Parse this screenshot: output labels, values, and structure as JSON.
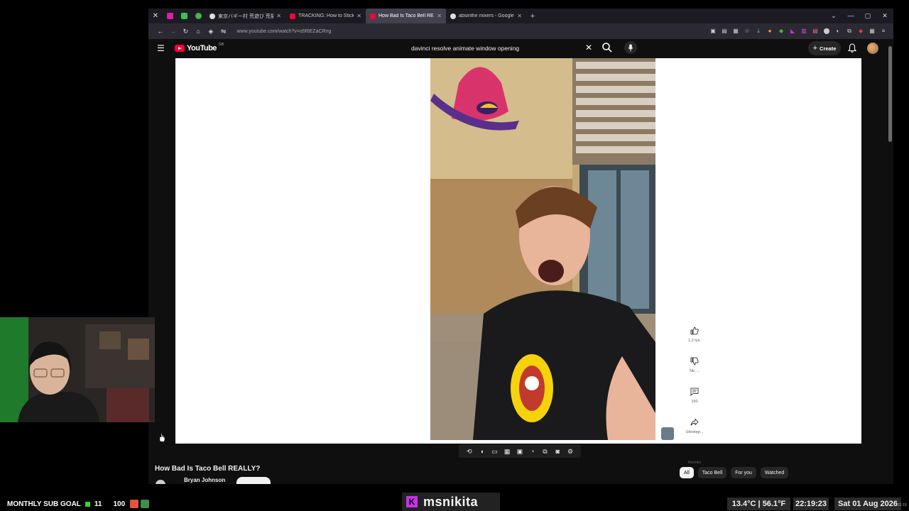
{
  "browser": {
    "tabs": [
      {
        "label": "東京バギー村 荒遊び 荒撮影 - ",
        "favicon": "globe",
        "active": false
      },
      {
        "label": "TRACKING: How to Stick an IMA",
        "favicon": "youtube",
        "active": false
      },
      {
        "label": "How Bad Is Taco Bell REALLY? -",
        "favicon": "youtube",
        "active": true
      },
      {
        "label": "absinthe mixers - Google Search",
        "favicon": "google",
        "active": false
      }
    ],
    "url": "www.youtube.com/watch?v=o5f6EZaCRng"
  },
  "youtube": {
    "logo_text": "YouTube",
    "country_code": "GB",
    "search_query": "davinci resolve animate window opening",
    "create_label": "Create"
  },
  "video": {
    "title": "How Bad Is Taco Bell REALLY?",
    "channel": "Bryan Johnson",
    "actions": [
      {
        "icon": "like-icon",
        "label": "1,2 tys."
      },
      {
        "icon": "dislike-icon",
        "label": "Nic ..."
      },
      {
        "icon": "comment-icon",
        "label": "150"
      },
      {
        "icon": "share-icon",
        "label": "Udostęp..."
      },
      {
        "icon": "remix-icon",
        "label": "Remiks"
      }
    ]
  },
  "chips": [
    "All",
    "Taco Bell",
    "For you",
    "Watched"
  ],
  "stream_overlay": {
    "sub_goal_label": "MONTHLY SUB GOAL",
    "sub_goal_current": "11",
    "sub_goal_target": "100",
    "handle": "msnikita",
    "temperature": "13.4°C | 56.1°F",
    "time": "22:19:23",
    "date": "Sat 01 Aug 2026",
    "tiny_time": "22:19"
  },
  "colors": {
    "yt_red": "#ff0033",
    "chip_active_bg": "#f1f1f1",
    "goal_green": "#3ad33a",
    "handle_accent": "#c832e8"
  }
}
